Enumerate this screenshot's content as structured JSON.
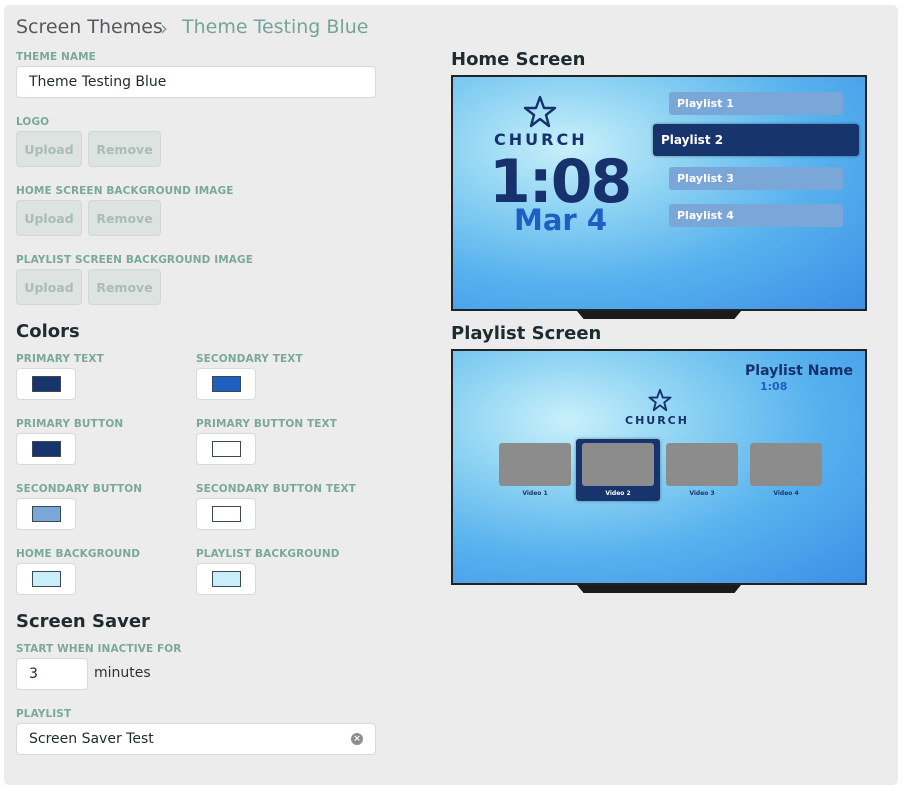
{
  "breadcrumb": {
    "root": "Screen Themes",
    "separator": "›",
    "current": "Theme Testing Blue"
  },
  "theme_name": {
    "label": "THEME NAME",
    "value": "Theme Testing Blue"
  },
  "logo": {
    "label": "LOGO",
    "upload": "Upload",
    "remove": "Remove"
  },
  "home_bg_image": {
    "label": "HOME SCREEN BACKGROUND IMAGE",
    "upload": "Upload",
    "remove": "Remove"
  },
  "playlist_bg_image": {
    "label": "PLAYLIST SCREEN BACKGROUND IMAGE",
    "upload": "Upload",
    "remove": "Remove"
  },
  "colors": {
    "title": "Colors",
    "items": [
      {
        "label": "PRIMARY TEXT",
        "color": "#17346d"
      },
      {
        "label": "SECONDARY TEXT",
        "color": "#1f5ec2"
      },
      {
        "label": "PRIMARY BUTTON",
        "color": "#17346d"
      },
      {
        "label": "PRIMARY BUTTON TEXT",
        "color": "#ffffff"
      },
      {
        "label": "SECONDARY BUTTON",
        "color": "#7ba6d8"
      },
      {
        "label": "SECONDARY BUTTON TEXT",
        "color": "#ffffff"
      },
      {
        "label": "HOME BACKGROUND",
        "color": "#c8eefa"
      },
      {
        "label": "PLAYLIST BACKGROUND",
        "color": "#c8eefa"
      }
    ]
  },
  "screen_saver": {
    "title": "Screen Saver",
    "inactive_label": "START WHEN INACTIVE FOR",
    "inactive_value": "3",
    "inactive_unit": "minutes",
    "playlist_label": "PLAYLIST",
    "playlist_value": "Screen Saver Test",
    "clear_icon": "clear-circle-icon"
  },
  "home_preview": {
    "title": "Home Screen",
    "logo_text": "CHURCH",
    "time": "1:08",
    "date": "Mar 4",
    "playlists": [
      "Playlist 1",
      "Playlist 2",
      "Playlist 3",
      "Playlist 4"
    ],
    "selected_index": 1
  },
  "playlist_preview": {
    "title": "Playlist Screen",
    "playlist_name": "Playlist Name",
    "time": "1:08",
    "logo_text": "CHURCH",
    "videos": [
      "Video 1",
      "Video 2",
      "Video 3",
      "Video 4"
    ],
    "selected_index": 1
  }
}
